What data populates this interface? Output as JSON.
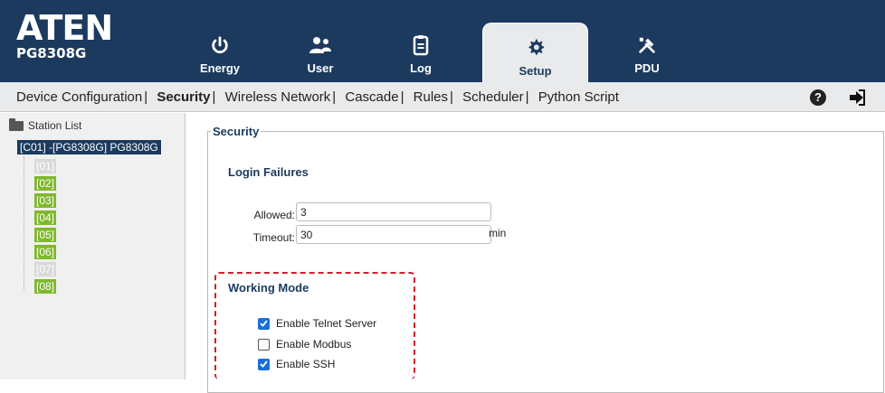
{
  "logo": {
    "main": "ATEN",
    "sub": "PG8308G"
  },
  "tabs": [
    {
      "label": "Energy",
      "icon": "power-icon",
      "active": false
    },
    {
      "label": "User",
      "icon": "users-icon",
      "active": false
    },
    {
      "label": "Log",
      "icon": "clipboard-icon",
      "active": false
    },
    {
      "label": "Setup",
      "icon": "gear-icon",
      "active": true
    },
    {
      "label": "PDU",
      "icon": "tools-icon",
      "active": false
    }
  ],
  "subnav": {
    "items": [
      "Device Configuration",
      "Security",
      "Wireless Network",
      "Cascade",
      "Rules",
      "Scheduler",
      "Python Script"
    ],
    "active": "Security",
    "separator": "|"
  },
  "tree": {
    "header": "Station List",
    "root": "[C01] -[PG8308G] PG8308G",
    "ports": [
      {
        "label": "[01]",
        "on": false
      },
      {
        "label": "[02]",
        "on": true
      },
      {
        "label": "[03]",
        "on": true
      },
      {
        "label": "[04]",
        "on": true
      },
      {
        "label": "[05]",
        "on": true
      },
      {
        "label": "[06]",
        "on": true
      },
      {
        "label": "[07]",
        "on": false
      },
      {
        "label": "[08]",
        "on": true
      }
    ]
  },
  "security": {
    "legend": "Security",
    "login_failures": {
      "title": "Login Failures",
      "allowed_label": "Allowed:",
      "allowed_value": "3",
      "timeout_label": "Timeout:",
      "timeout_value": "30",
      "timeout_unit": "min"
    },
    "working_mode": {
      "title": "Working Mode",
      "options": [
        {
          "label": "Enable Telnet Server",
          "checked": true
        },
        {
          "label": "Enable Modbus",
          "checked": false
        },
        {
          "label": "Enable SSH",
          "checked": true
        }
      ]
    }
  },
  "colors": {
    "header_bg": "#1c3a5e",
    "port_on": "#7fb82d",
    "port_off": "#d9d9d9",
    "highlight_border": "#d0202a",
    "checkbox": "#1a6fd6"
  }
}
